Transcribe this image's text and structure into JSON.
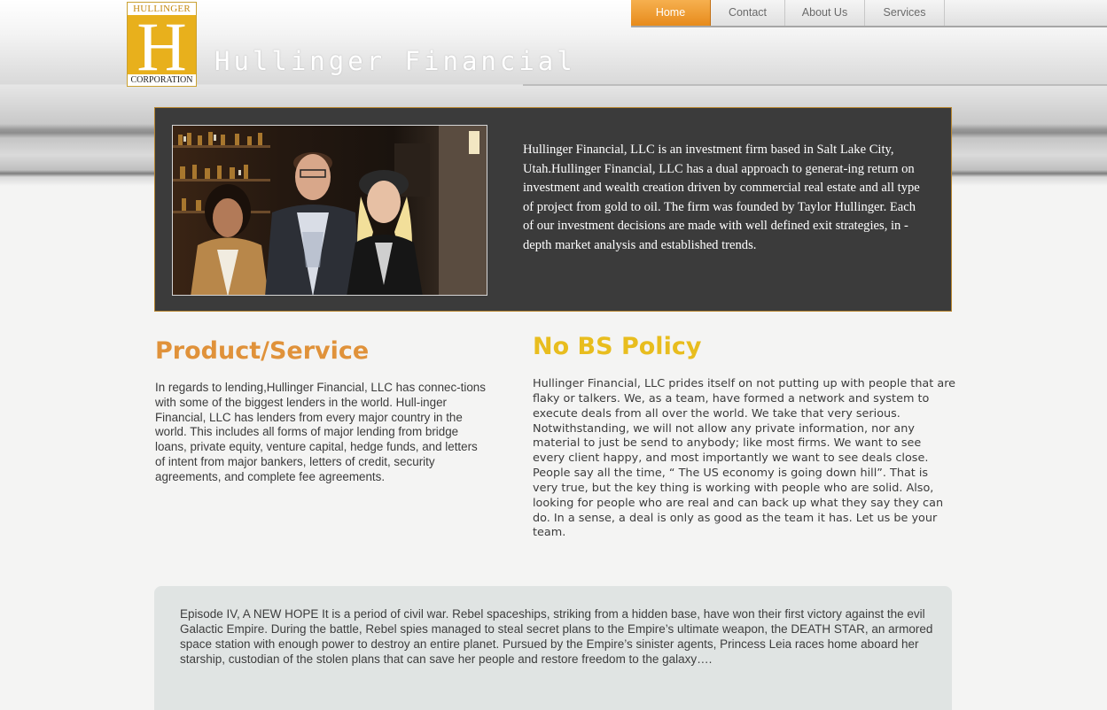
{
  "header": {
    "logo_top": "HULLINGER",
    "logo_letter": "H",
    "logo_bottom": "CORPORATION",
    "site_title": "Hullinger Financial"
  },
  "nav": {
    "items": [
      {
        "label": "Home",
        "active": true
      },
      {
        "label": "Contact",
        "active": false
      },
      {
        "label": "About Us",
        "active": false
      },
      {
        "label": "Services",
        "active": false
      }
    ]
  },
  "feature": {
    "text": "Hullinger Financial, LLC is an investment firm based in Salt Lake City, Utah.Hullinger Financial, LLC has a dual approach to generat-ing return on investment and wealth creation driven by commercial real estate and all type of project from gold to oil. The firm was founded by Taylor Hullinger. Each of our investment decisions are made with well defined exit strategies, in - depth market analysis and established trends."
  },
  "product": {
    "title": "Product/Service",
    "text": "In regards to lending,Hullinger Financial, LLC has connec-tions with some of the biggest lenders in the world. Hull-inger Financial, LLC has lenders from every major country in the world. This includes all forms of major lending from bridge loans, private equity, venture capital, hedge funds, and letters of intent from major bankers, letters of credit, security agreements, and complete fee agreements."
  },
  "policy": {
    "title": "No BS Policy",
    "text": "Hullinger Financial, LLC prides itself on not putting up with people that are flaky or talkers. We, as a team, have formed a network and system to execute deals from all over the world. We take that very serious. Notwithstanding, we will not allow any private information, nor any material to just be send to anybody; like most firms. We want to see every client happy, and most importantly we want to see deals close. People say all the time, “ The US economy is going down hill”. That is very true, but the key thing is working with people who are solid. Also, looking for people who are real and can back up what they say they can do. In a sense, a deal is only as good as the team it has. Let us be your team."
  },
  "bottom": {
    "text": "Episode IV, A NEW HOPE It is a period of civil war. Rebel spaceships, striking from a hidden base, have won their first victory against the evil Galactic Empire. During the battle, Rebel spies managed to steal secret plans to the Empire’s ultimate weapon, the DEATH STAR, an armored space station with enough power to destroy an entire planet. Pursued by the Empire’s sinister agents, Princess Leia races home aboard her starship, custodian of the stolen plans that can save her people and restore freedom to the galaxy…."
  },
  "colors": {
    "accent_orange": "#e78b1c",
    "title_orange": "#e0923a",
    "title_gold": "#e8bd1e",
    "logo_gold": "#e8b01c",
    "feature_bg": "#3b3b3b"
  }
}
